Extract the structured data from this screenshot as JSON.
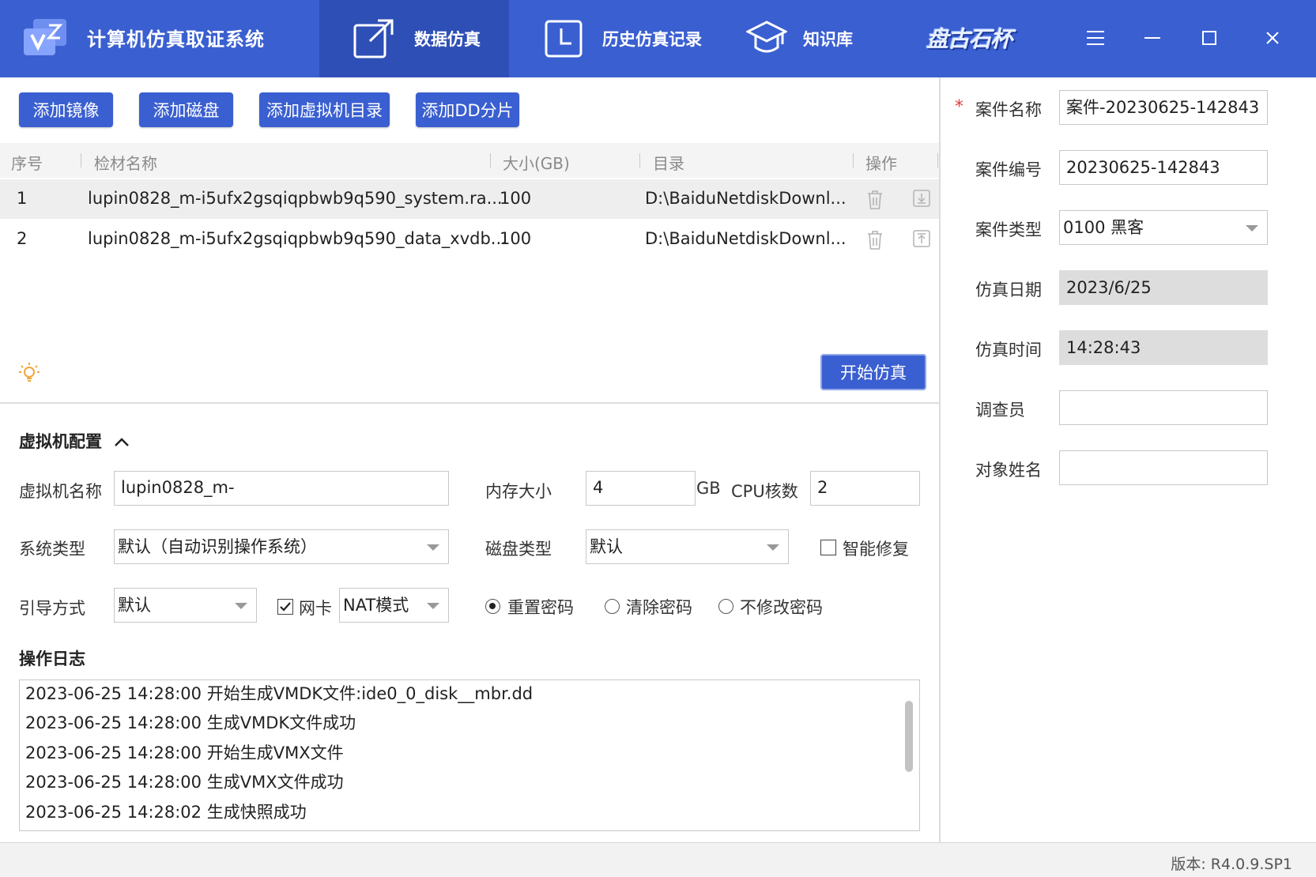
{
  "header": {
    "app_title": "计算机仿真取证系统",
    "brand": "盘古石杯",
    "tabs": [
      {
        "label": "数据仿真",
        "icon": "export-icon",
        "active": true
      },
      {
        "label": "历史仿真记录",
        "icon": "clock-icon",
        "active": false
      },
      {
        "label": "知识库",
        "icon": "graduation-cap-icon",
        "active": false
      }
    ],
    "accent_color": "#3a5fd0"
  },
  "toolbar": {
    "add_image": "添加镜像",
    "add_disk": "添加磁盘",
    "add_vm_dir": "添加虚拟机目录",
    "add_dd_split": "添加DD分片"
  },
  "table": {
    "columns": [
      "序号",
      "检材名称",
      "大小(GB)",
      "目录",
      "操作"
    ],
    "rows": [
      {
        "index": "1",
        "name": "lupin0828_m-i5ufx2gsqiqpbwb9q590_system.ra...",
        "size": "100",
        "dir": "D:\\BaiduNetdiskDownl..."
      },
      {
        "index": "2",
        "name": "lupin0828_m-i5ufx2gsqiqpbwb9q590_data_xvdb...",
        "size": "100",
        "dir": "D:\\BaiduNetdiskDownl..."
      }
    ]
  },
  "start_button": "开始仿真",
  "vm_config": {
    "title": "虚拟机配置",
    "vm_name_label": "虚拟机名称",
    "vm_name_value": "lupin0828_m-",
    "memory_label": "内存大小",
    "memory_value": "4",
    "memory_unit": "GB",
    "cpu_label": "CPU核数",
    "cpu_value": "2",
    "os_type_label": "系统类型",
    "os_type_value": "默认（自动识别操作系统）",
    "disk_type_label": "磁盘类型",
    "disk_type_value": "默认",
    "smart_repair_label": "智能修复",
    "smart_repair_checked": false,
    "boot_label": "引导方式",
    "boot_value": "默认",
    "nic_label": "网卡",
    "nic_checked": true,
    "nic_mode": "NAT模式",
    "password_options": [
      "重置密码",
      "清除密码",
      "不修改密码"
    ],
    "password_selected": 0
  },
  "log": {
    "title": "操作日志",
    "lines": [
      "2023-06-25 14:28:00 开始生成VMDK文件:ide0_0_disk__mbr.dd",
      "2023-06-25 14:28:00 生成VMDK文件成功",
      "2023-06-25 14:28:00 开始生成VMX文件",
      "2023-06-25 14:28:00 生成VMX文件成功",
      "2023-06-25 14:28:02 生成快照成功"
    ]
  },
  "case": {
    "name_label": "案件名称",
    "name_value": "案件-20230625-142843",
    "number_label": "案件编号",
    "number_value": "20230625-142843",
    "type_label": "案件类型",
    "type_value": "0100 黑客",
    "date_label": "仿真日期",
    "date_value": "2023/6/25",
    "time_label": "仿真时间",
    "time_value": "14:28:43",
    "investigator_label": "调查员",
    "investigator_value": "",
    "subject_label": "对象姓名",
    "subject_value": ""
  },
  "footer": {
    "version": "版本:    R4.0.9.SP1"
  }
}
